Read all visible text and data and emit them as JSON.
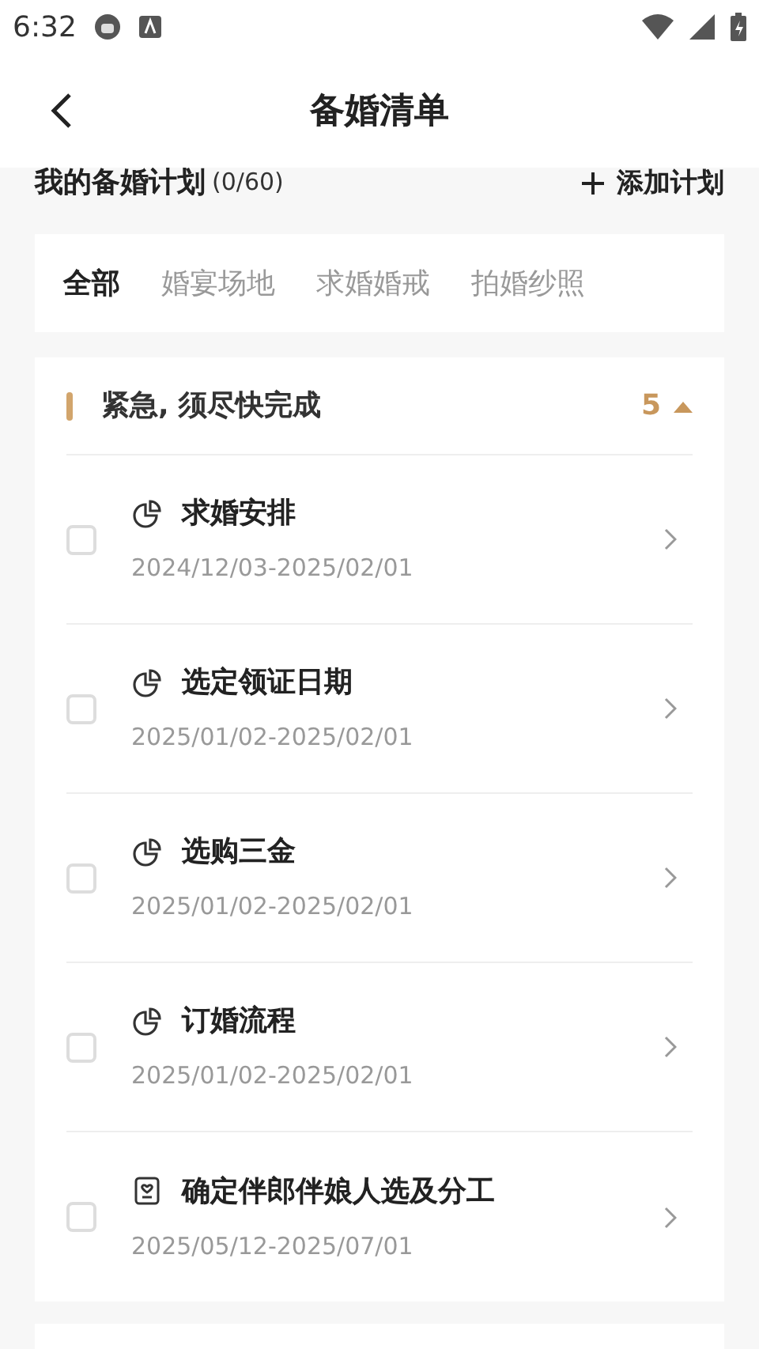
{
  "status_bar": {
    "time": "6:32"
  },
  "header": {
    "title": "备婚清单"
  },
  "plan": {
    "title": "我的备婚计划",
    "count": "(0/60)",
    "add_label": "添加计划"
  },
  "tabs": [
    {
      "label": "全部",
      "selected": true
    },
    {
      "label": "婚宴场地",
      "selected": false
    },
    {
      "label": "求婚婚戒",
      "selected": false
    },
    {
      "label": "拍婚纱照",
      "selected": false
    }
  ],
  "group": {
    "title": "紧急, 须尽快完成",
    "count": "5",
    "expanded": true,
    "items": [
      {
        "kind": "pie",
        "title": "求婚安排",
        "dates": "2024/12/03-2025/02/01",
        "checked": false
      },
      {
        "kind": "pie",
        "title": "选定领证日期",
        "dates": "2025/01/02-2025/02/01",
        "checked": false
      },
      {
        "kind": "pie",
        "title": "选购三金",
        "dates": "2025/01/02-2025/02/01",
        "checked": false
      },
      {
        "kind": "pie",
        "title": "订婚流程",
        "dates": "2025/01/02-2025/02/01",
        "checked": false
      },
      {
        "kind": "heart",
        "title": "确定伴郎伴娘人选及分工",
        "dates": "2025/05/12-2025/07/01",
        "checked": false
      }
    ]
  }
}
